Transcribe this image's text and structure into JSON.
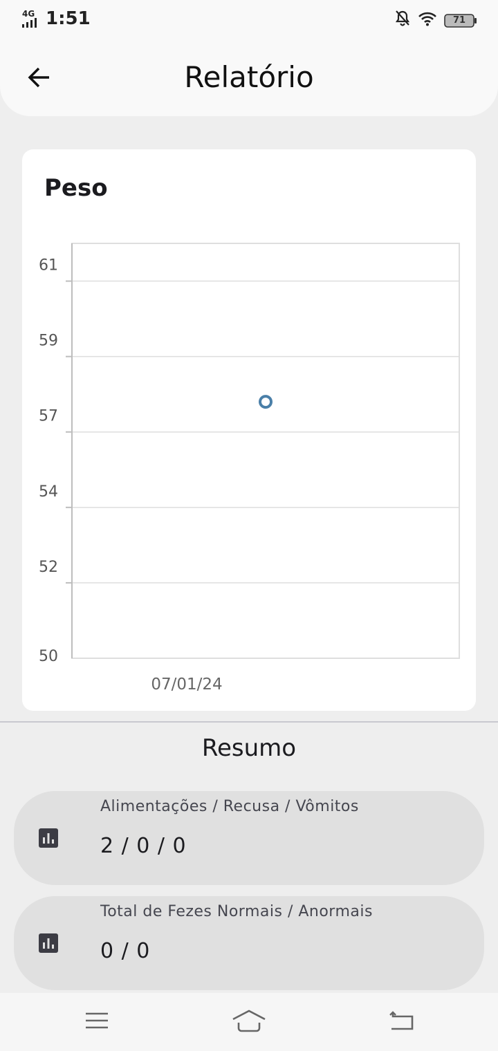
{
  "status_bar": {
    "network": "4G",
    "time": "1:51",
    "battery": "71",
    "icons": [
      "signal-icon",
      "bell-off-icon",
      "wifi-icon",
      "battery-icon"
    ]
  },
  "app_bar": {
    "title": "Relatório",
    "back_icon": "arrow-back-icon"
  },
  "weight_card": {
    "title": "Peso"
  },
  "chart_data": {
    "type": "scatter",
    "x": [
      "07/01/24"
    ],
    "y": [
      56.8
    ],
    "ylim": [
      50,
      61
    ],
    "ytick_values": [
      50,
      52,
      54,
      56,
      58,
      60
    ],
    "yticks": [
      "50",
      "52",
      "54",
      "57",
      "59",
      "61"
    ],
    "xtick_labels": [
      "07/01/24"
    ],
    "grid": true,
    "marker": "hollow-circle",
    "color": "#4a7fa8"
  },
  "summary": {
    "title": "Resumo",
    "items": [
      {
        "label": "Alimentações / Recusa / Vômitos",
        "value": "2 / 0 / 0",
        "icon": "bar-chart-icon"
      },
      {
        "label": "Total de Fezes Normais / Anormais",
        "value": "0 / 0",
        "icon": "bar-chart-icon"
      }
    ]
  },
  "nav_bar": {
    "icons": [
      "menu-icon",
      "home-icon",
      "back-icon"
    ]
  },
  "colors": {
    "background": "#eeeeee",
    "surface": "#ffffff",
    "summary_item": "#e0e0e0",
    "point": "#4a7fa8"
  }
}
